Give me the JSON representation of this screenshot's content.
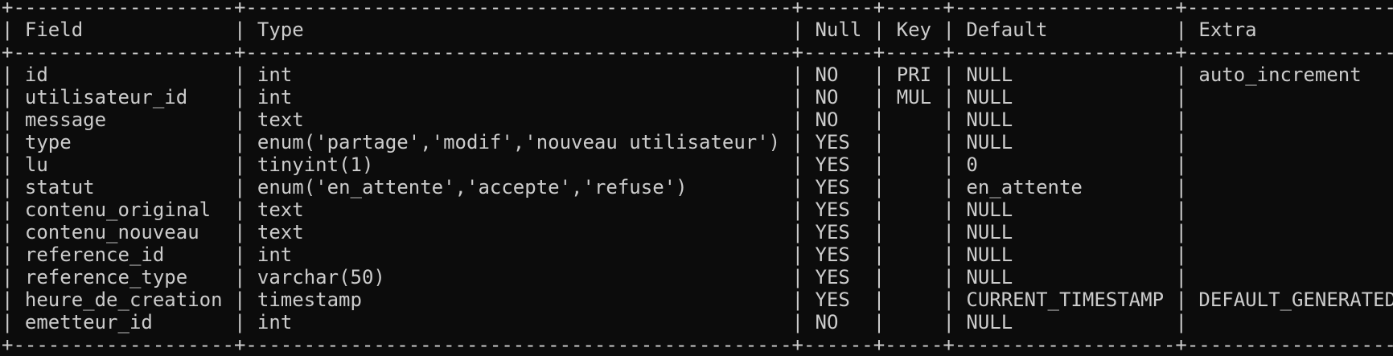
{
  "table": {
    "columns": [
      "Field",
      "Type",
      "Null",
      "Key",
      "Default",
      "Extra"
    ],
    "rows": [
      [
        "id",
        "int",
        "NO",
        "PRI",
        "NULL",
        "auto_increment"
      ],
      [
        "utilisateur_id",
        "int",
        "NO",
        "MUL",
        "NULL",
        ""
      ],
      [
        "message",
        "text",
        "NO",
        "",
        "NULL",
        ""
      ],
      [
        "type",
        "enum('partage','modif','nouveau utilisateur')",
        "YES",
        "",
        "NULL",
        ""
      ],
      [
        "lu",
        "tinyint(1)",
        "YES",
        "",
        "0",
        ""
      ],
      [
        "statut",
        "enum('en_attente','accepte','refuse')",
        "YES",
        "",
        "en_attente",
        ""
      ],
      [
        "contenu_original",
        "text",
        "YES",
        "",
        "NULL",
        ""
      ],
      [
        "contenu_nouveau",
        "text",
        "YES",
        "",
        "NULL",
        ""
      ],
      [
        "reference_id",
        "int",
        "YES",
        "",
        "NULL",
        ""
      ],
      [
        "reference_type",
        "varchar(50)",
        "YES",
        "",
        "NULL",
        ""
      ],
      [
        "heure_de_creation",
        "timestamp",
        "YES",
        "",
        "CURRENT_TIMESTAMP",
        "DEFAULT_GENERATED"
      ],
      [
        "emetteur_id",
        "int",
        "NO",
        "",
        "NULL",
        ""
      ]
    ]
  },
  "colors": {
    "background": "#0c0c0c",
    "foreground": "#cccccc"
  }
}
